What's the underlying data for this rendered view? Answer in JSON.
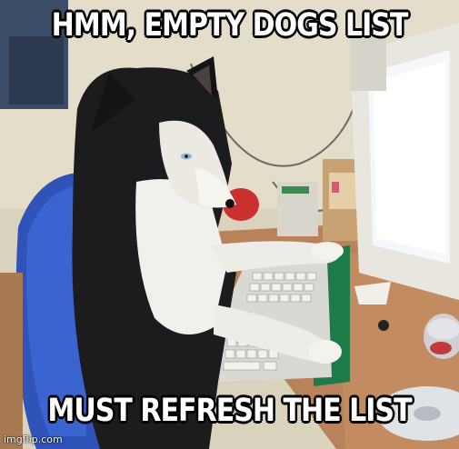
{
  "meme": {
    "top_text": "HMM, EMPTY DOGS LIST",
    "bottom_text": "MUST REFRESH THE LIST",
    "watermark": "imgflip.com"
  }
}
